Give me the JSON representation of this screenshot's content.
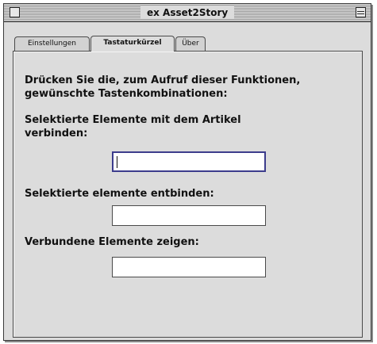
{
  "window": {
    "title": "ex Asset2Story"
  },
  "tabs": [
    {
      "label": "Einstellungen",
      "active": false
    },
    {
      "label": "Tastaturkürzel",
      "active": true
    },
    {
      "label": "Über",
      "active": false
    }
  ],
  "panel": {
    "intro_line1": "Drücken Sie die, zum Aufruf dieser Funktionen,",
    "intro_line2": "gewünschte Tastenkombinationen:",
    "link_label_line1": "Selektierte Elemente mit dem Artikel",
    "link_label_line2": "verbinden:",
    "link_value": "",
    "unlink_label": "Selektierte elemente entbinden:",
    "unlink_value": "",
    "show_label": "Verbundene Elemente zeigen:",
    "show_value": ""
  }
}
